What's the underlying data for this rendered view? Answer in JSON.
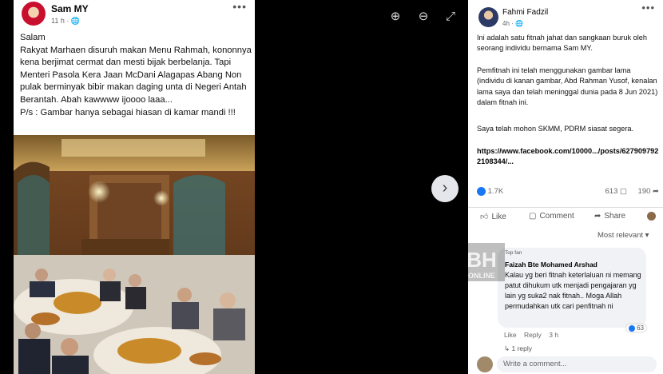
{
  "left_post": {
    "author": "Sam MY",
    "time": "11 h · 🌐",
    "more": "•••",
    "text": "Salam\nRakyat Marhaen disuruh makan Menu Rahmah, kononnya kena berjimat cermat dan mesti bijak berbelanja. Tapi Menteri Pasola Kera Jaan McDani Alagapas Abang Non pulak berminyak bibir makan daging unta di Negeri Antah Berantah. Abah kawwww ijoooo laaa...\nP/s : Gambar hanya sebagai hiasan di kamar mandi !!!"
  },
  "viewer": {
    "zoom_in_icon": "⊕",
    "zoom_out_icon": "⊖",
    "expand_icon": "⤢",
    "next_icon": "›"
  },
  "right_post": {
    "author": "Fahmi Fadzil",
    "time": "4h · 🌐",
    "more": "•••",
    "para1": "Ini adalah satu fitnah jahat dan sangkaan buruk oleh seorang individu bernama Sam MY.",
    "para2": "Pemfitnah ini telah menggunakan gambar lama (individu di kanan gambar, Abd Rahman Yusof, kenalan lama saya dan telah meninggal dunia pada 8 Jun 2021) dalam fitnah ini.",
    "para3": "Saya telah mohon SKMM, PDRM siasat segera.",
    "link": "https://www.facebook.com/10000.../posts/6279097922108344/...",
    "likes": "1.7K",
    "comments": "613",
    "shares": "190",
    "like_label": "Like",
    "comment_label": "Comment",
    "share_label": "Share",
    "most_relevant": "Most relevant ▾",
    "comment": {
      "tag": "Top fan",
      "name": "Faizah Bte Mohamed Arshad",
      "text": "Kalau yg beri fitnah keterlaluan ni memang patut dihukum utk menjadi pengajaran yg lain yg suka2 nak fitnah.. Moga Allah permudahkan utk cari penfitnah ni",
      "reactions": "63",
      "like": "Like",
      "reply": "Reply",
      "time": "3 h",
      "replies": "1 reply"
    },
    "write_placeholder": "Write a comment..."
  },
  "watermark": {
    "logo": "BH",
    "sub": "ONLINE"
  },
  "colors": {
    "fb_blue": "#1877f2",
    "bg_black": "#000000"
  }
}
